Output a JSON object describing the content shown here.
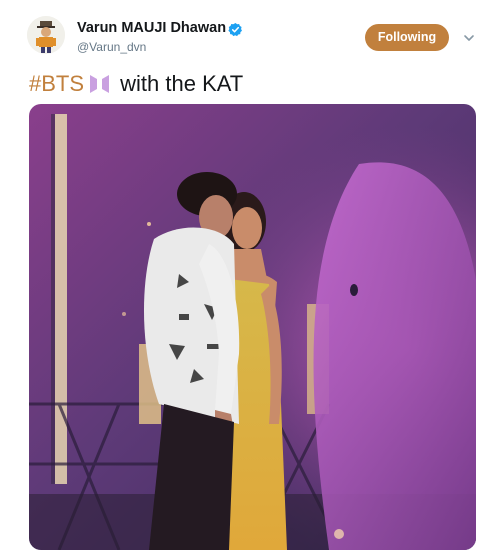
{
  "user": {
    "display_name": "Varun MAUJI Dhawan",
    "handle": "@Varun_dvn",
    "verified": true
  },
  "actions": {
    "follow_label": "Following"
  },
  "tweet": {
    "hashtag": "#BTS",
    "emoji": "bts-logo-emoji",
    "text": " with the KAT"
  },
  "colors": {
    "accent": "#c1803d",
    "verified": "#1da1f2",
    "text": "#14171a",
    "muted": "#657786"
  },
  "icons": {
    "verified": "verified-badge-icon",
    "menu": "chevron-down-icon"
  }
}
